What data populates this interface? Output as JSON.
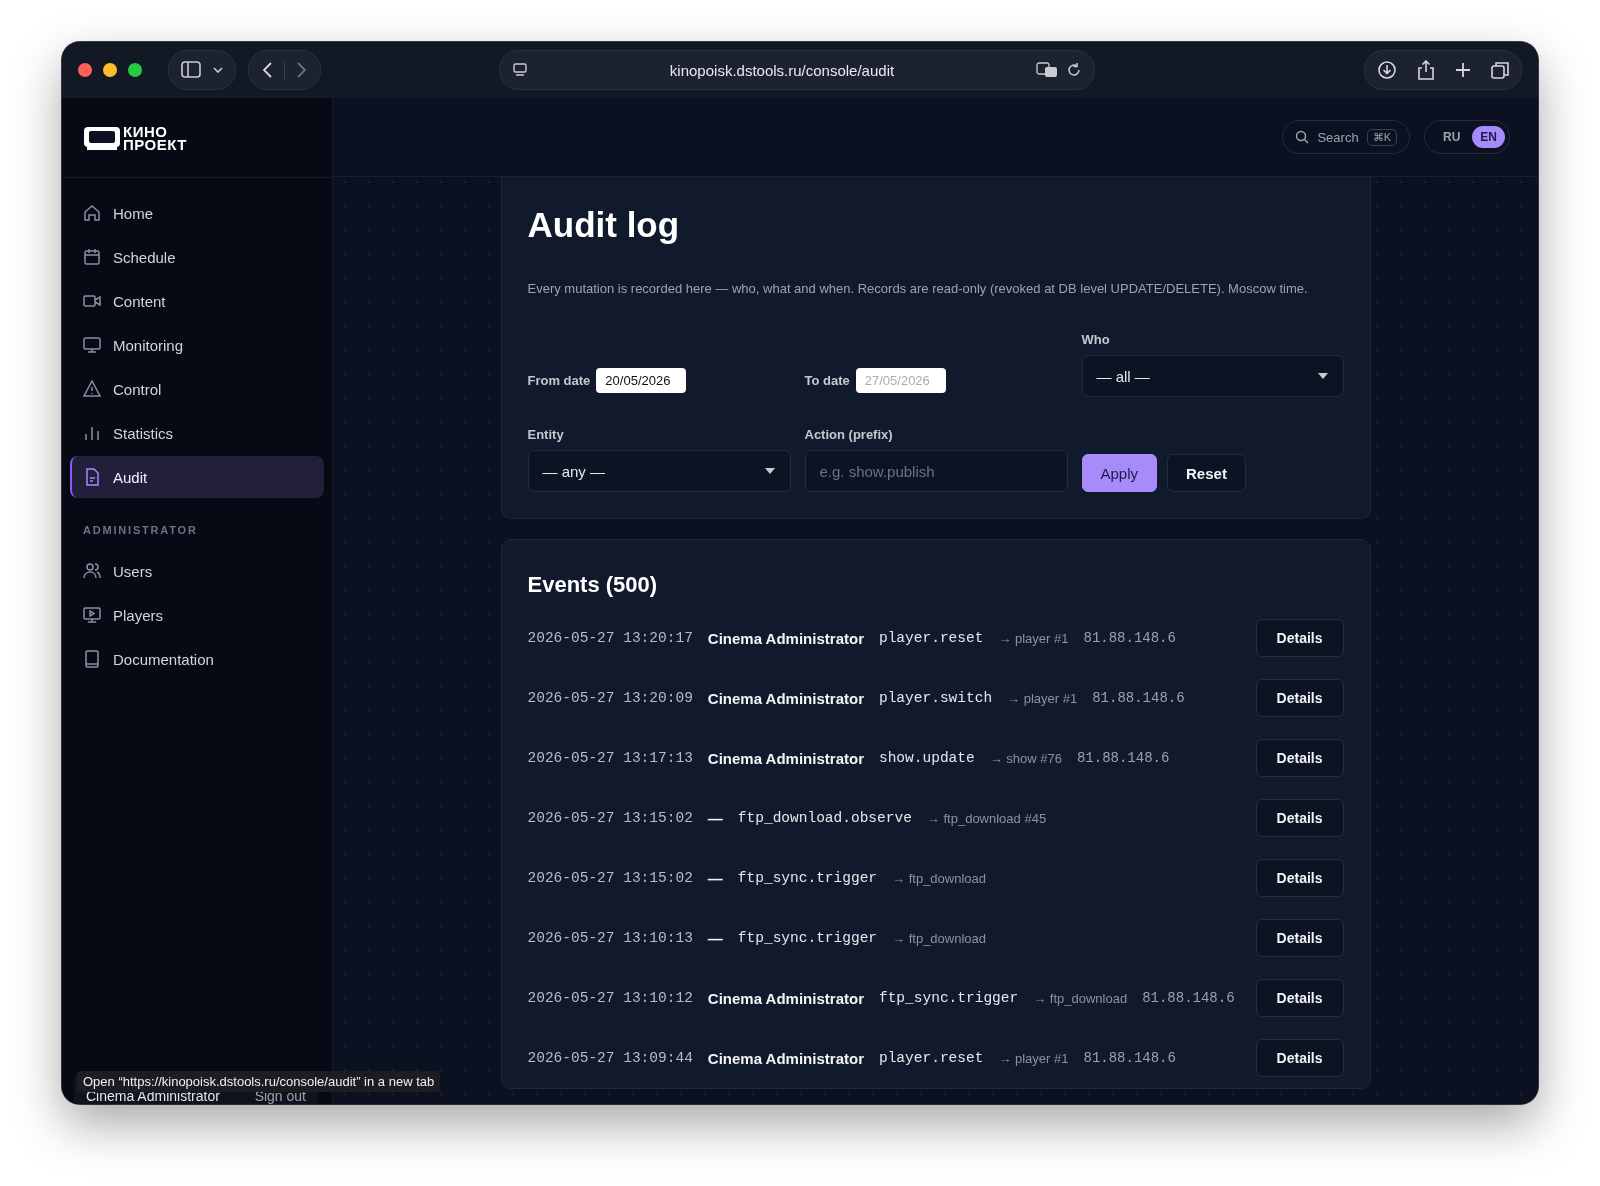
{
  "browser": {
    "url": "kinopoisk.dstools.ru/console/audit"
  },
  "logo": {
    "line_1": "КИНО",
    "line_2": "ПРОЕКТ"
  },
  "header": {
    "search": {
      "label": "Search",
      "shortcut": "⌘K"
    },
    "languages": [
      {
        "label": "RU",
        "selected": false
      },
      {
        "label": "EN",
        "selected": true
      }
    ]
  },
  "sidebar": {
    "items": [
      {
        "label": "Home",
        "selected": false
      },
      {
        "label": "Schedule",
        "selected": false
      },
      {
        "label": "Content",
        "selected": false
      },
      {
        "label": "Monitoring",
        "selected": false
      },
      {
        "label": "Control",
        "selected": false
      },
      {
        "label": "Statistics",
        "selected": false
      },
      {
        "label": "Audit",
        "selected": true
      }
    ],
    "section_title": "ADMINISTRATOR",
    "admin_items": [
      {
        "label": "Users",
        "selected": false
      },
      {
        "label": "Players",
        "selected": false
      },
      {
        "label": "Documentation",
        "selected": false
      }
    ],
    "user": {
      "name": "Cinema Administrator",
      "sign_out": "Sign out"
    }
  },
  "audit": {
    "title": "Audit log",
    "description": "Every mutation is recorded here — who, what and when. Records are read-only (revoked at DB level UPDATE/DELETE). Moscow time.",
    "filters": {
      "from_date": {
        "label": "From date",
        "value": "20/05/2026"
      },
      "to_date": {
        "label": "To date",
        "placeholder": "27/05/2026"
      },
      "who": {
        "label": "Who",
        "value": "— all —"
      },
      "entity": {
        "label": "Entity",
        "value": "— any —"
      },
      "action": {
        "label": "Action (prefix)",
        "placeholder": "e.g. show.publish"
      },
      "buttons": [
        {
          "label": "Apply",
          "kind": "primary"
        },
        {
          "label": "Reset",
          "kind": "secondary"
        }
      ]
    }
  },
  "events": {
    "title": "Events (500)",
    "rows": [
      {
        "time": "2026-05-27 13:20:17",
        "actor": "Cinema Administrator",
        "action": "player.reset",
        "target": "→ player #1",
        "ip": "81.88.148.6",
        "button": "Details"
      },
      {
        "time": "2026-05-27 13:20:09",
        "actor": "Cinema Administrator",
        "action": "player.switch",
        "target": "→ player #1",
        "ip": "81.88.148.6",
        "button": "Details"
      },
      {
        "time": "2026-05-27 13:17:13",
        "actor": "Cinema Administrator",
        "action": "show.update",
        "target": "→ show #76",
        "ip": "81.88.148.6",
        "button": "Details"
      },
      {
        "time": "2026-05-27 13:15:02",
        "actor": "—",
        "action": "ftp_download.observe",
        "target": "→ ftp_download #45",
        "button": "Details"
      },
      {
        "time": "2026-05-27 13:15:02",
        "actor": "—",
        "action": "ftp_sync.trigger",
        "target": "→ ftp_download",
        "button": "Details"
      },
      {
        "time": "2026-05-27 13:10:13",
        "actor": "—",
        "action": "ftp_sync.trigger",
        "target": "→ ftp_download",
        "button": "Details"
      },
      {
        "time": "2026-05-27 13:10:12",
        "actor": "Cinema Administrator",
        "action": "ftp_sync.trigger",
        "target": "→ ftp_download",
        "ip": "81.88.148.6",
        "button": "Details"
      },
      {
        "time": "2026-05-27 13:09:44",
        "actor": "Cinema Administrator",
        "action": "player.reset",
        "target": "→ player #1",
        "ip": "81.88.148.6",
        "button": "Details"
      }
    ]
  },
  "status_tooltip": "Open “https://kinopoisk.dstools.ru/console/audit” in a new tab"
}
